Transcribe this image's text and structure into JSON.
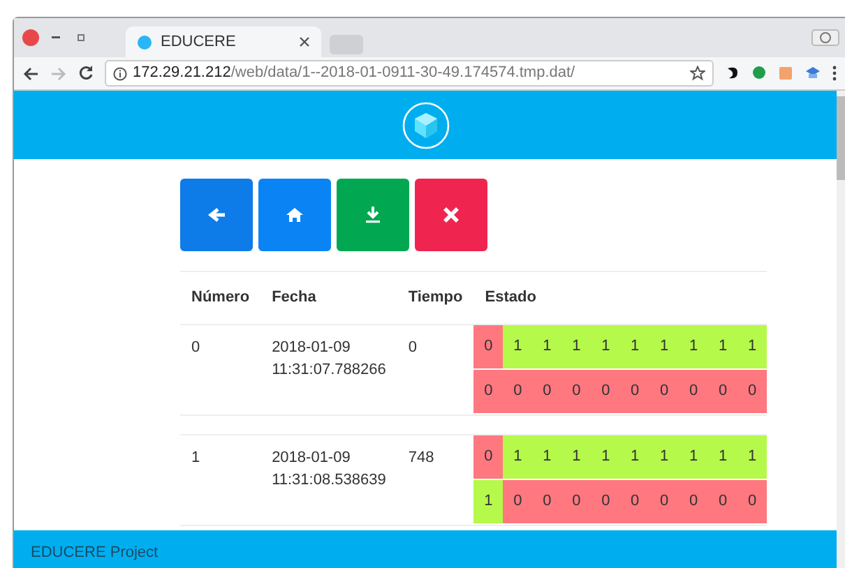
{
  "browser": {
    "tab_title": "EDUCERE",
    "url_host": "172.29.21.212",
    "url_path": "/web/data/1--2018-01-0911-30-49.174574.tmp.dat/"
  },
  "toolbar": [
    {
      "kind": "back",
      "color": "#0d7be8"
    },
    {
      "kind": "home",
      "color": "#0a84f5"
    },
    {
      "kind": "download",
      "color": "#02a851"
    },
    {
      "kind": "delete",
      "color": "#ef2550"
    }
  ],
  "table": {
    "columns": [
      "Número",
      "Fecha",
      "Tiempo",
      "Estado"
    ],
    "rows": [
      {
        "numero": "0",
        "fecha": "2018-01-09 11:31:07.788266",
        "tiempo": "0",
        "estado": [
          [
            {
              "value": "0",
              "on": false
            },
            {
              "value": "1",
              "on": true
            },
            {
              "value": "1",
              "on": true
            },
            {
              "value": "1",
              "on": true
            },
            {
              "value": "1",
              "on": true
            },
            {
              "value": "1",
              "on": true
            },
            {
              "value": "1",
              "on": true
            },
            {
              "value": "1",
              "on": true
            },
            {
              "value": "1",
              "on": true
            },
            {
              "value": "1",
              "on": true
            }
          ],
          [
            {
              "value": "0",
              "on": false
            },
            {
              "value": "0",
              "on": false
            },
            {
              "value": "0",
              "on": false
            },
            {
              "value": "0",
              "on": false
            },
            {
              "value": "0",
              "on": false
            },
            {
              "value": "0",
              "on": false
            },
            {
              "value": "0",
              "on": false
            },
            {
              "value": "0",
              "on": false
            },
            {
              "value": "0",
              "on": false
            },
            {
              "value": "0",
              "on": false
            }
          ]
        ]
      },
      {
        "numero": "1",
        "fecha": "2018-01-09 11:31:08.538639",
        "tiempo": "748",
        "estado": [
          [
            {
              "value": "0",
              "on": false
            },
            {
              "value": "1",
              "on": true
            },
            {
              "value": "1",
              "on": true
            },
            {
              "value": "1",
              "on": true
            },
            {
              "value": "1",
              "on": true
            },
            {
              "value": "1",
              "on": true
            },
            {
              "value": "1",
              "on": true
            },
            {
              "value": "1",
              "on": true
            },
            {
              "value": "1",
              "on": true
            },
            {
              "value": "1",
              "on": true
            }
          ],
          [
            {
              "value": "1",
              "on": true
            },
            {
              "value": "0",
              "on": false
            },
            {
              "value": "0",
              "on": false
            },
            {
              "value": "0",
              "on": false
            },
            {
              "value": "0",
              "on": false
            },
            {
              "value": "0",
              "on": false
            },
            {
              "value": "0",
              "on": false
            },
            {
              "value": "0",
              "on": false
            },
            {
              "value": "0",
              "on": false
            },
            {
              "value": "0",
              "on": false
            }
          ]
        ]
      }
    ]
  },
  "footer": "EDUCERE Project"
}
